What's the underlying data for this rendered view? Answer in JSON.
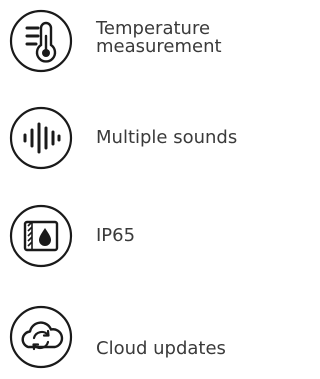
{
  "features": [
    {
      "icon": "thermometer-icon",
      "label_line1": "Temperature",
      "label_line2": "measurement"
    },
    {
      "icon": "sound-waves-icon",
      "label": "Multiple sounds"
    },
    {
      "icon": "water-drop-icon",
      "label": "IP65"
    },
    {
      "icon": "cloud-sync-icon",
      "label": "Cloud updates"
    }
  ],
  "colors": {
    "icon_stroke": "#1a1a1a",
    "text": "#3a3a3a"
  }
}
